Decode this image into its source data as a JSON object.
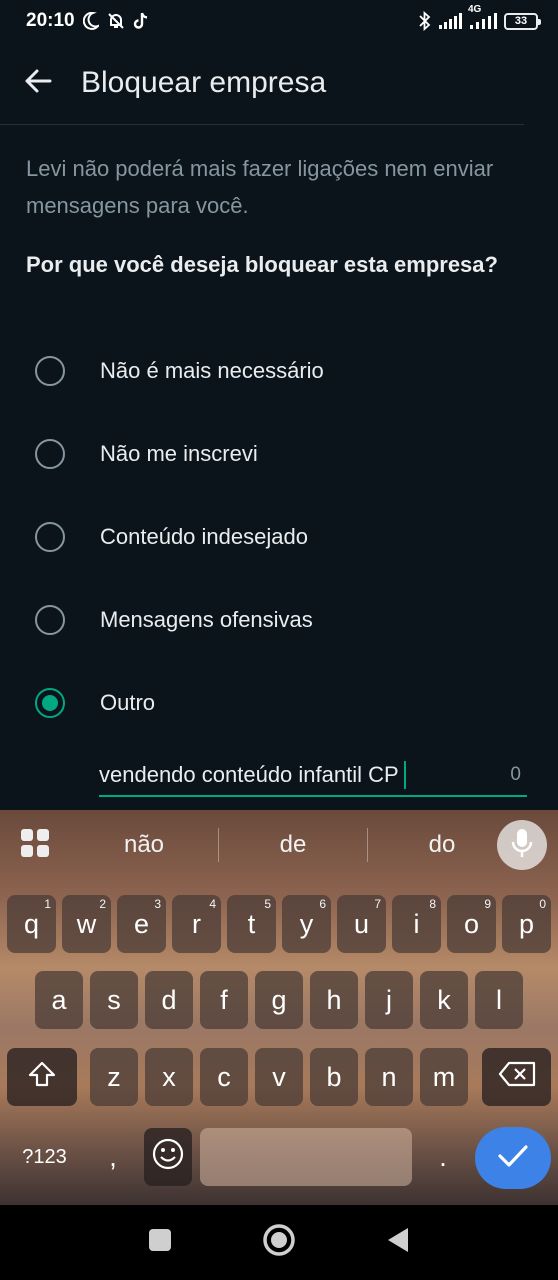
{
  "status_bar": {
    "time": "20:10",
    "network_label": "4G",
    "battery_level": "33",
    "icons": [
      "moon-icon",
      "bell-off-icon",
      "tiktok-icon",
      "bluetooth-icon",
      "signal-icon",
      "signal-4g-icon",
      "battery-icon"
    ]
  },
  "app_bar": {
    "back_icon": "arrow-left-icon",
    "title": "Bloquear empresa"
  },
  "content": {
    "description": "Levi não poderá mais fazer ligações nem enviar mensagens para você.",
    "question": "Por que você deseja bloquear esta empresa?",
    "options": [
      {
        "label": "Não é mais necessário",
        "selected": false
      },
      {
        "label": "Não me inscrevi",
        "selected": false
      },
      {
        "label": "Conteúdo indesejado",
        "selected": false
      },
      {
        "label": "Mensagens ofensivas",
        "selected": false
      },
      {
        "label": "Outro",
        "selected": true
      }
    ],
    "reason_input": {
      "value": "vendendo conteúdo infantil CP",
      "char_counter": "0"
    },
    "accent_color": "#00a884"
  },
  "keyboard": {
    "suggestions": [
      "não",
      "de",
      "do"
    ],
    "row1": [
      {
        "key": "q",
        "hint": "1"
      },
      {
        "key": "w",
        "hint": "2"
      },
      {
        "key": "e",
        "hint": "3"
      },
      {
        "key": "r",
        "hint": "4"
      },
      {
        "key": "t",
        "hint": "5"
      },
      {
        "key": "y",
        "hint": "6"
      },
      {
        "key": "u",
        "hint": "7"
      },
      {
        "key": "i",
        "hint": "8"
      },
      {
        "key": "o",
        "hint": "9"
      },
      {
        "key": "p",
        "hint": "0"
      }
    ],
    "row2": [
      "a",
      "s",
      "d",
      "f",
      "g",
      "h",
      "j",
      "k",
      "l"
    ],
    "row3": [
      "z",
      "x",
      "c",
      "v",
      "b",
      "n",
      "m"
    ],
    "symbols_key": "?123",
    "comma_key": ",",
    "period_key": ".",
    "enter_color": "#3d82e6"
  },
  "nav_bar": {
    "icons": [
      "recents-square-icon",
      "home-circle-icon",
      "back-triangle-icon"
    ]
  }
}
